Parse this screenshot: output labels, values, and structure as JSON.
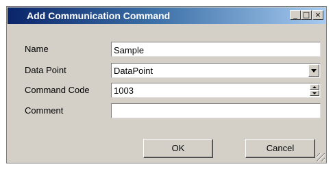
{
  "window": {
    "title": "Add Communication Command",
    "minimize_glyph": "_",
    "maximize_glyph": "□",
    "close_glyph": "×"
  },
  "form": {
    "name": {
      "label": "Name",
      "value": "Sample"
    },
    "data_point": {
      "label": "Data Point",
      "value": "DataPoint"
    },
    "command_code": {
      "label": "Command Code",
      "value": "1003"
    },
    "comment": {
      "label": "Comment",
      "value": ""
    }
  },
  "buttons": {
    "ok": "OK",
    "cancel": "Cancel"
  },
  "colors": {
    "title_bar_start": "#0a246a",
    "title_bar_end": "#a6caf0",
    "dialog_face": "#d4d0c8"
  }
}
